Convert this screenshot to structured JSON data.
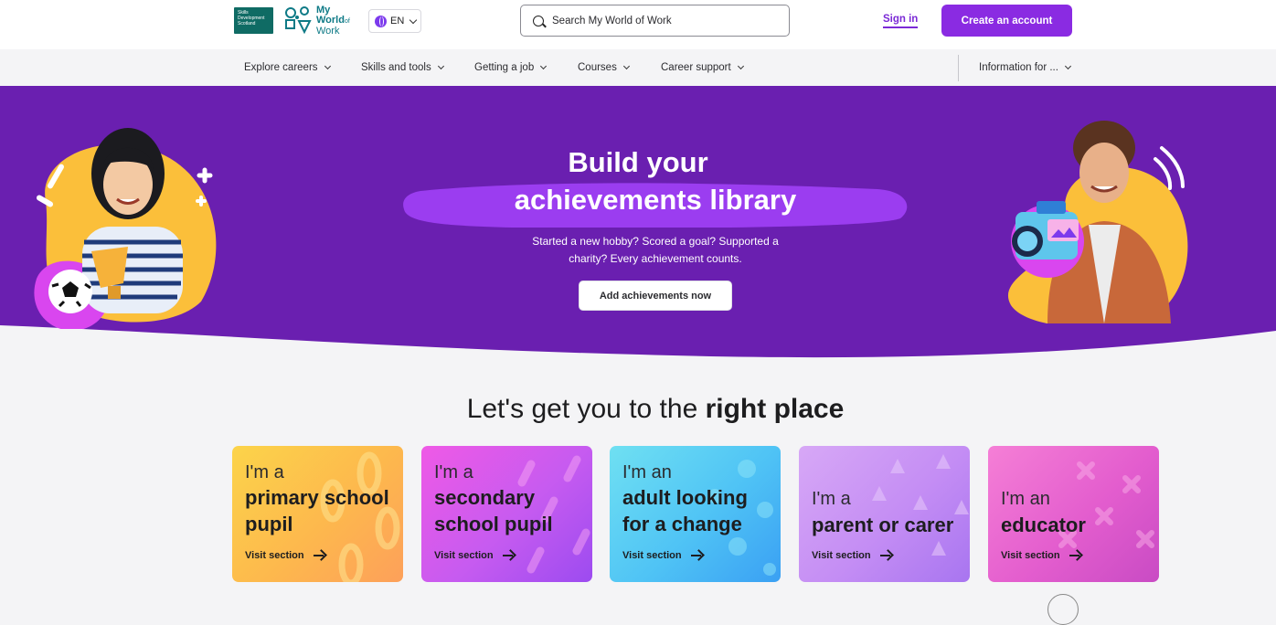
{
  "header": {
    "sds_logo_lines": [
      "Skills",
      "Development",
      "Scotland"
    ],
    "brand": {
      "line1": "My",
      "line2": "World",
      "of": "of",
      "line3": "Work"
    },
    "language": "EN",
    "search_placeholder": "Search My World of Work",
    "sign_in": "Sign in",
    "create_account": "Create an account"
  },
  "nav": {
    "items": [
      {
        "label": "Explore careers"
      },
      {
        "label": "Skills and tools"
      },
      {
        "label": "Getting a job"
      },
      {
        "label": "Courses"
      },
      {
        "label": "Career support"
      }
    ],
    "info_for": "Information for ..."
  },
  "hero": {
    "title_line1": "Build your",
    "title_line2": "achievements library",
    "subtitle": "Started a new hobby? Scored a goal? Supported a charity? Every achievement counts.",
    "cta": "Add achievements now"
  },
  "section": {
    "title_plain": "Let's get you to the ",
    "title_bold": "right place"
  },
  "cards": [
    {
      "pre": "I'm a",
      "main_line1": "primary school",
      "main_line2": "pupil",
      "visit": "Visit section"
    },
    {
      "pre": "I'm a",
      "main_line1": "secondary",
      "main_line2": "school pupil",
      "visit": "Visit section"
    },
    {
      "pre": "I'm an",
      "main_line1": "adult looking",
      "main_line2": "for a change",
      "visit": "Visit section"
    },
    {
      "pre": "I'm a",
      "main_line1": "parent or carer",
      "main_line2": "",
      "visit": "Visit section"
    },
    {
      "pre": "I'm an",
      "main_line1": "educator",
      "main_line2": "",
      "visit": "Visit section"
    }
  ],
  "colors": {
    "brand_purple": "#8a2be2",
    "hero_purple": "#6a1fb0",
    "brush_purple": "#9b3df0",
    "teal": "#0f6b64"
  },
  "icons": [
    "globe-icon",
    "chevron-down-icon",
    "search-icon",
    "arrow-right-icon"
  ]
}
